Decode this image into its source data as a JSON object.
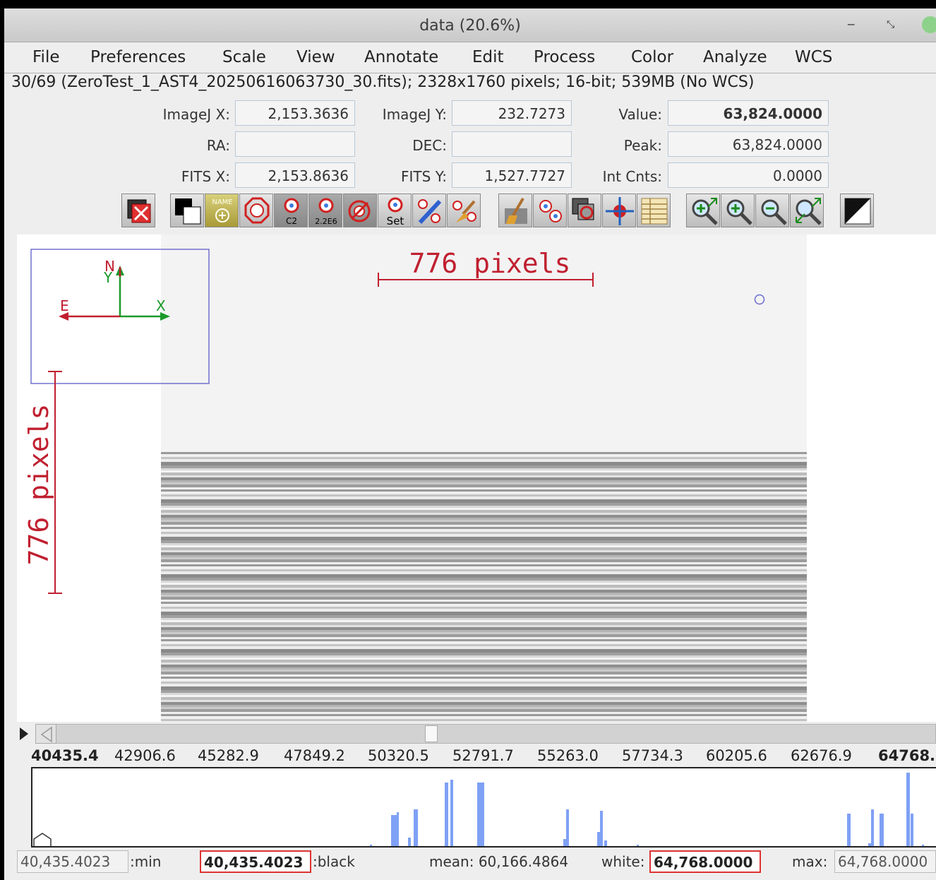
{
  "window": {
    "title": "data (20.6%)",
    "controls": [
      "minimize-icon",
      "restore-icon",
      "close-icon"
    ]
  },
  "menu": [
    "File",
    "Preferences",
    "Scale",
    "View",
    "Annotate",
    "Edit",
    "Process",
    "Color",
    "Analyze",
    "WCS"
  ],
  "info_line": "30/69 (ZeroTest_1_AST4_20250616063730_30.fits); 2328x1760 pixels; 16-bit; 539MB (No WCS)",
  "fields": {
    "imagej_x": {
      "label": "ImageJ X:",
      "value": "2,153.3636"
    },
    "imagej_y": {
      "label": "ImageJ Y:",
      "value": "232.7273"
    },
    "value": {
      "label": "Value:",
      "value": "63,824.0000"
    },
    "ra": {
      "label": "RA:",
      "value": ""
    },
    "dec": {
      "label": "DEC:",
      "value": ""
    },
    "peak": {
      "label": "Peak:",
      "value": "63,824.0000"
    },
    "fits_x": {
      "label": "FITS X:",
      "value": "2,153.8636"
    },
    "fits_y": {
      "label": "FITS Y:",
      "value": "1,527.7727"
    },
    "int_cnts": {
      "label": "Int Cnts:",
      "value": "0.0000"
    }
  },
  "toolbar": {
    "close_all": {
      "icon": "close-all-icon"
    },
    "group2": [
      {
        "icon": "invert-icon"
      },
      {
        "icon": "name-aperture-icon",
        "text": "NAME"
      },
      {
        "icon": "aperture-ring-icon"
      },
      {
        "icon": "centroid-aperture-icon",
        "text": "C2"
      },
      {
        "icon": "aperture-value-icon",
        "text": "2.2E6"
      },
      {
        "icon": "clear-aperture-icon"
      },
      {
        "icon": "set-aperture-icon",
        "text": "Set"
      },
      {
        "icon": "annotate-pen-icon"
      },
      {
        "icon": "clear-annotations-icon"
      }
    ],
    "group3": [
      {
        "icon": "broom-icon"
      },
      {
        "icon": "multi-aperture-icon"
      },
      {
        "icon": "stack-align-icon"
      },
      {
        "icon": "crosshair-icon"
      },
      {
        "icon": "table-icon"
      }
    ],
    "group4": [
      {
        "icon": "zoom-in-fit-icon"
      },
      {
        "icon": "zoom-in-icon"
      },
      {
        "icon": "zoom-out-icon"
      },
      {
        "icon": "zoom-fit-icon"
      }
    ],
    "contrast": {
      "icon": "contrast-icon"
    }
  },
  "overlay": {
    "compass": {
      "n": "N",
      "y": "Y",
      "e": "E",
      "x": "X"
    },
    "h_scale_label": "776 pixels",
    "v_scale_label": "776 pixels"
  },
  "histogram": {
    "ticks": [
      "40435.4",
      "42906.6",
      "45282.9",
      "47849.2",
      "50320.5",
      "52791.7",
      "55263.0",
      "57734.3",
      "60205.6",
      "62676.9",
      "64768."
    ],
    "bar_color": "#7fa1f5"
  },
  "stats": {
    "min_value": "40,435.4023",
    "min_label": ":min",
    "black_value": "40,435.4023",
    "black_label": ":black",
    "mean": "mean: 60,166.4864",
    "white_label": "white:",
    "white_value": "64,768.0000",
    "max_label": "max:",
    "max_value": "64,768.0000"
  }
}
